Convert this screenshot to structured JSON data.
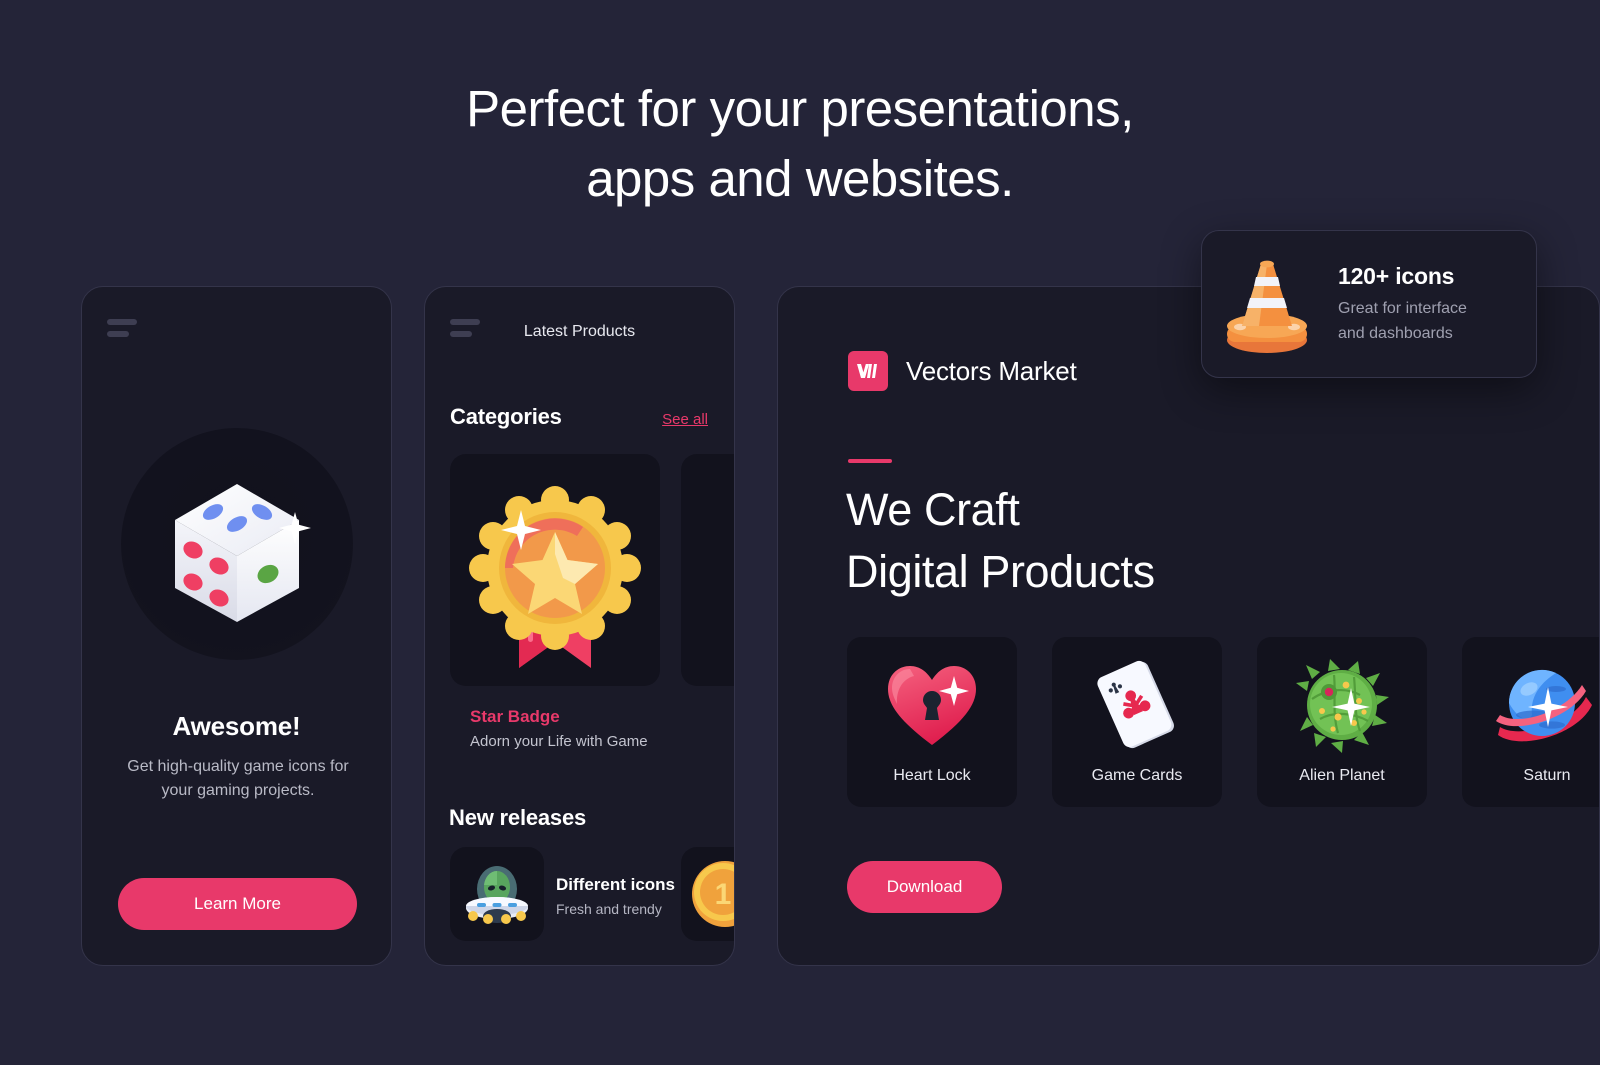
{
  "page": {
    "background_color": "#242438",
    "accent_color": "#e8396a",
    "card_color": "#1a1a28",
    "headline_line1": "Perfect for your presentations,",
    "headline_line2": "apps and websites."
  },
  "awesome_card": {
    "menu_icon": "hamburger-icon",
    "hero_icon": "dice-icon",
    "title": "Awesome!",
    "description": "Get high-quality game icons for your gaming projects.",
    "button_label": "Learn More"
  },
  "latest_card": {
    "menu_icon": "hamburger-icon",
    "header": "Latest Products",
    "categories_heading": "Categories",
    "see_all_label": "See all",
    "categories": [
      {
        "icon": "star-badge-icon",
        "name": "Star Badge",
        "subtitle": "Adorn your Life with Game"
      }
    ],
    "new_releases_heading": "New releases",
    "new_releases": [
      {
        "icon": "ufo-alien-icon",
        "title": "Different icons",
        "subtitle": "Fresh and trendy"
      },
      {
        "icon": "gold-coin-icon",
        "title": "",
        "subtitle": ""
      }
    ]
  },
  "market_card": {
    "brand_logo_icon": "vectors-market-logo",
    "brand_name": "Vectors Market",
    "heading_line1": "We Craft",
    "heading_line2": "Digital Products",
    "tiles": [
      {
        "icon": "heart-lock-icon",
        "label": "Heart Lock"
      },
      {
        "icon": "game-cards-icon",
        "label": "Game Cards"
      },
      {
        "icon": "alien-planet-icon",
        "label": "Alien Planet"
      },
      {
        "icon": "saturn-icon",
        "label": "Saturn"
      }
    ],
    "button_label": "Download"
  },
  "floating_card": {
    "icon": "traffic-cone-icon",
    "title": "120+ icons",
    "subtitle_line1": "Great for interface",
    "subtitle_line2": "and dashboards"
  }
}
